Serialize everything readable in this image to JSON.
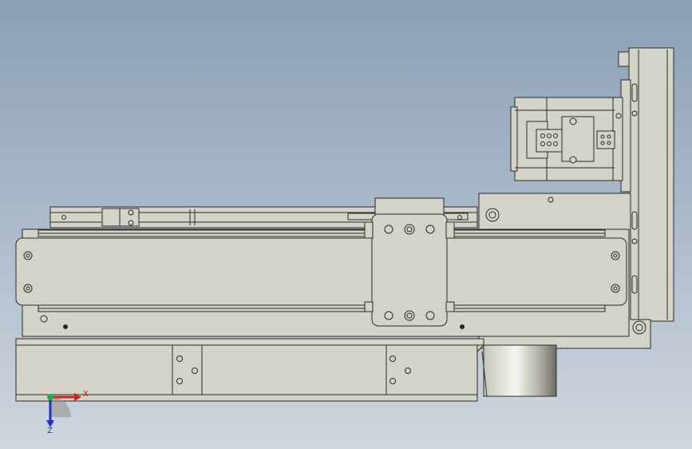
{
  "viewport": {
    "background_top": "#8a9fb6",
    "background_bottom": "#cfd6de"
  },
  "model": {
    "part_fill": "#d4d3c7",
    "edge_color": "#2a2a2a"
  },
  "triad": {
    "x_label": "X",
    "z_label": "Z",
    "x_color": "#d42020",
    "y_color": "#22b03a",
    "z_color": "#2030c8"
  }
}
